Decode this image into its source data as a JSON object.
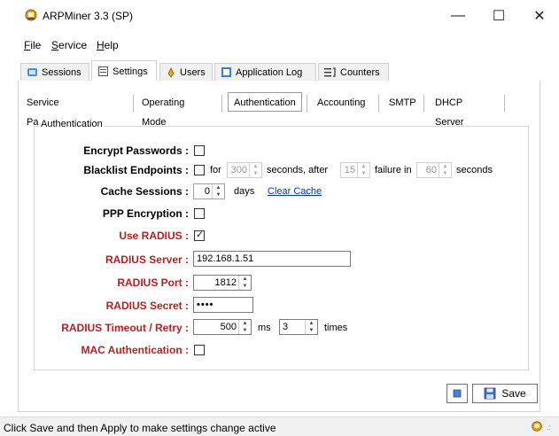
{
  "window": {
    "title": "ARPMiner 3.3 (SP)",
    "minimize": "—",
    "maximize": "☐",
    "close": "✕"
  },
  "menu": {
    "file": "File",
    "service": "Service",
    "help": "Help"
  },
  "main_tabs": [
    {
      "label": "Sessions",
      "icon": "sessions-icon"
    },
    {
      "label": "Settings",
      "icon": "settings-icon"
    },
    {
      "label": "Users",
      "icon": "users-icon"
    },
    {
      "label": "Application Log",
      "icon": "log-icon"
    },
    {
      "label": "Counters",
      "icon": "counters-icon"
    }
  ],
  "active_main_tab": "Settings",
  "sub_tabs": [
    "Service Parameters",
    "Operating Mode",
    "Authentication",
    "Accounting",
    "SMTP",
    "DHCP Server"
  ],
  "active_sub_tab": "Authentication",
  "group_label": "Authentication",
  "fields": {
    "encrypt_passwords": {
      "label": "Encrypt Passwords :",
      "checked": false
    },
    "blacklist": {
      "label": "Blacklist Endpoints :",
      "checked": false,
      "for": "for",
      "seconds_val": "300",
      "seconds_after": "seconds, after",
      "failures_val": "15",
      "failure_in": "failure in",
      "window_val": "60",
      "seconds": "seconds"
    },
    "cache_sessions": {
      "label": "Cache Sessions :",
      "value": "0",
      "days": "days",
      "clear_cache": "Clear Cache"
    },
    "ppp_encryption": {
      "label": "PPP Encryption :",
      "checked": false
    },
    "use_radius": {
      "label": "Use RADIUS :",
      "checked": true
    },
    "radius_server": {
      "label": "RADIUS Server :",
      "value": "192.168.1.51"
    },
    "radius_port": {
      "label": "RADIUS Port :",
      "value": "1812"
    },
    "radius_secret": {
      "label": "RADIUS Secret :",
      "value": "••••"
    },
    "radius_timeout": {
      "label": "RADIUS Timeout / Retry :",
      "timeout_val": "500",
      "ms": "ms",
      "retry_val": "3",
      "times": "times"
    },
    "mac_auth": {
      "label": "MAC Authentication :",
      "checked": false
    }
  },
  "buttons": {
    "save": "Save"
  },
  "status": {
    "text": "Click Save and then Apply to make settings change active"
  },
  "colors": {
    "required_label": "#b22222",
    "link": "#0033cc"
  }
}
